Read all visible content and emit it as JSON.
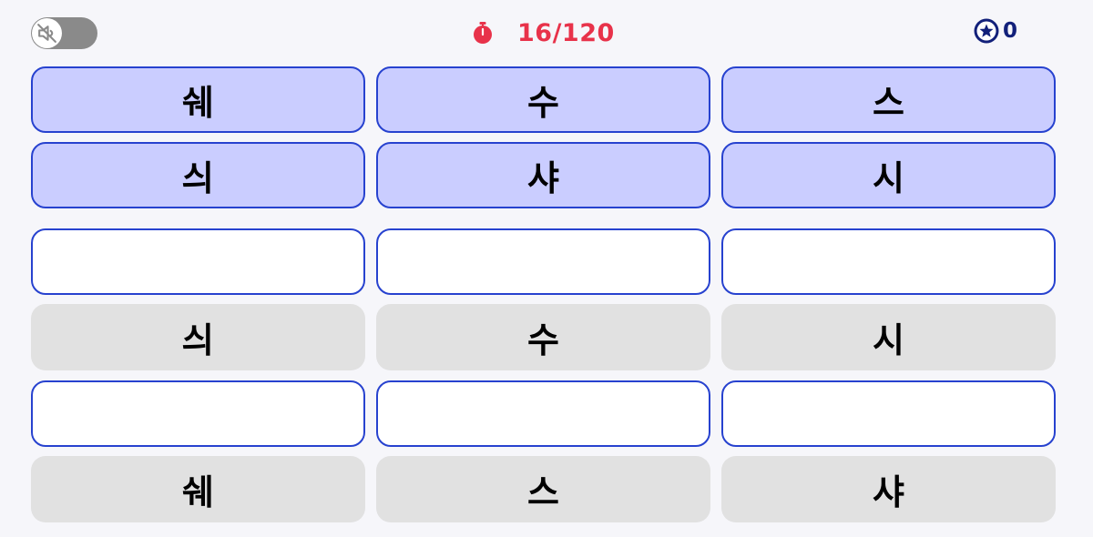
{
  "header": {
    "sound_toggle": {
      "state": "muted",
      "icon": "speaker-muted-icon"
    },
    "timer": {
      "text": "16/120",
      "icon": "stopwatch-icon",
      "color": "#e8324a"
    },
    "stars": {
      "count": "0",
      "icon": "star-badge-icon",
      "color": "#12207a"
    }
  },
  "board": {
    "target_rows": [
      [
        "쉐",
        "수",
        "스"
      ],
      [
        "싀",
        "샤",
        "시"
      ]
    ],
    "answer_rows": [
      {
        "slots": [
          "",
          "",
          ""
        ],
        "choices": [
          "싀",
          "수",
          "시"
        ]
      },
      {
        "slots": [
          "",
          "",
          ""
        ],
        "choices": [
          "쉐",
          "스",
          "샤"
        ]
      }
    ]
  },
  "colors": {
    "target_fill": "#cacdff",
    "tile_border": "#2742cf",
    "choice_fill": "#e1e1e1",
    "background": "#f6f6fa"
  }
}
